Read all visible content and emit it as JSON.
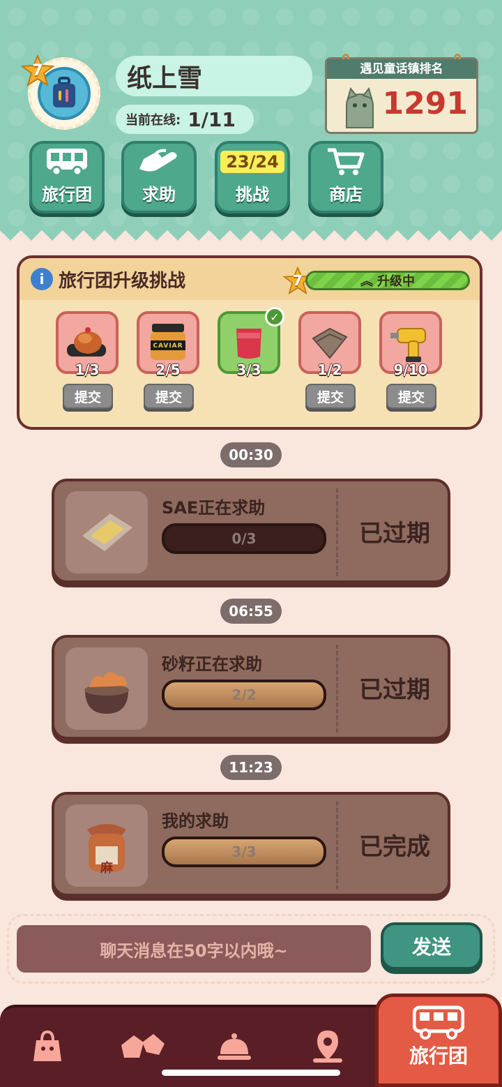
{
  "player": {
    "level": "7",
    "name": "纸上雪",
    "online_label": "当前在线:",
    "online_value": "1/11"
  },
  "ranking": {
    "title": "遇见童话镇排名",
    "value": "1291"
  },
  "nav": [
    {
      "label": "旅行团",
      "icon": "bus-icon"
    },
    {
      "label": "求助",
      "icon": "helping-hand-icon"
    },
    {
      "label": "挑战",
      "badge": "23/24"
    },
    {
      "label": "商店",
      "icon": "shopping-cart-icon"
    }
  ],
  "challenge": {
    "title": "旅行团升级挑战",
    "level": "7",
    "status": "升级中",
    "items": [
      {
        "icon": "roast-meat-icon",
        "count": "1/3",
        "submit": "提交",
        "done": false
      },
      {
        "icon": "caviar-jar-icon",
        "caviar_label": "CAVIAR",
        "count": "2/5",
        "submit": "提交",
        "done": false
      },
      {
        "icon": "jam-jar-icon",
        "count": "3/3",
        "done": true
      },
      {
        "icon": "cloth-bundle-icon",
        "count": "1/2",
        "submit": "提交",
        "done": false
      },
      {
        "icon": "power-drill-icon",
        "count": "9/10",
        "submit": "提交",
        "done": false
      }
    ]
  },
  "requests": [
    {
      "time": "00:30",
      "who": "SAE正在求助",
      "progress": "0/3",
      "progress_fraction": 0.0,
      "status": "已过期",
      "icon": "butter-wrap-icon"
    },
    {
      "time": "06:55",
      "who": "砂籽正在求助",
      "progress": "2/2",
      "progress_fraction": 1.0,
      "status": "已过期",
      "icon": "shrimp-bowl-icon"
    },
    {
      "time": "11:23",
      "who": "我的求助",
      "progress": "3/3",
      "progress_fraction": 1.0,
      "status": "已完成",
      "icon": "sauce-jar-icon",
      "jar_label": "麻"
    }
  ],
  "chat": {
    "placeholder": "聊天消息在50字以内哦~",
    "send": "发送"
  },
  "tabs": [
    {
      "icon": "shopping-bag-icon"
    },
    {
      "icon": "handshake-icon"
    },
    {
      "icon": "service-bell-icon"
    },
    {
      "icon": "map-pin-icon"
    },
    {
      "icon": "bus-icon",
      "label": "旅行团",
      "active": true
    }
  ],
  "colors": {
    "top_bg": "#8fcfba",
    "page_bg": "#f9e6dc",
    "accent_red": "#e35b45",
    "rank_red": "#c8382e"
  }
}
